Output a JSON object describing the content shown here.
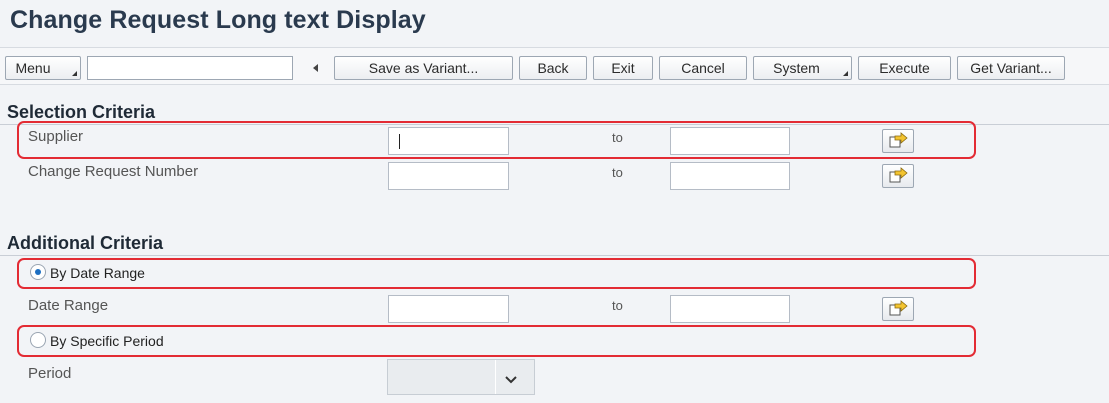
{
  "header": {
    "title": "Change Request Long text Display"
  },
  "toolbar": {
    "menu_label": "Menu",
    "command_value": "",
    "save_variant_label": "Save as Variant...",
    "back_label": "Back",
    "exit_label": "Exit",
    "cancel_label": "Cancel",
    "system_label": "System",
    "execute_label": "Execute",
    "get_variant_label": "Get Variant..."
  },
  "selection": {
    "heading": "Selection Criteria",
    "rows": [
      {
        "label": "Supplier",
        "to": "to",
        "from_value": "",
        "to_value": ""
      },
      {
        "label": "Change Request Number",
        "to": "to",
        "from_value": "",
        "to_value": ""
      }
    ]
  },
  "additional": {
    "heading": "Additional Criteria",
    "by_date_range_label": "By Date Range",
    "by_date_range_selected": true,
    "date_range": {
      "label": "Date Range",
      "to": "to",
      "from_value": "",
      "to_value": ""
    },
    "by_specific_period_label": "By Specific Period",
    "by_specific_period_selected": false,
    "period": {
      "label": "Period",
      "selected": ""
    }
  },
  "colors": {
    "highlight": "#e32b34",
    "radio_selected": "#1d6fc2",
    "title": "#2a3a4e"
  }
}
